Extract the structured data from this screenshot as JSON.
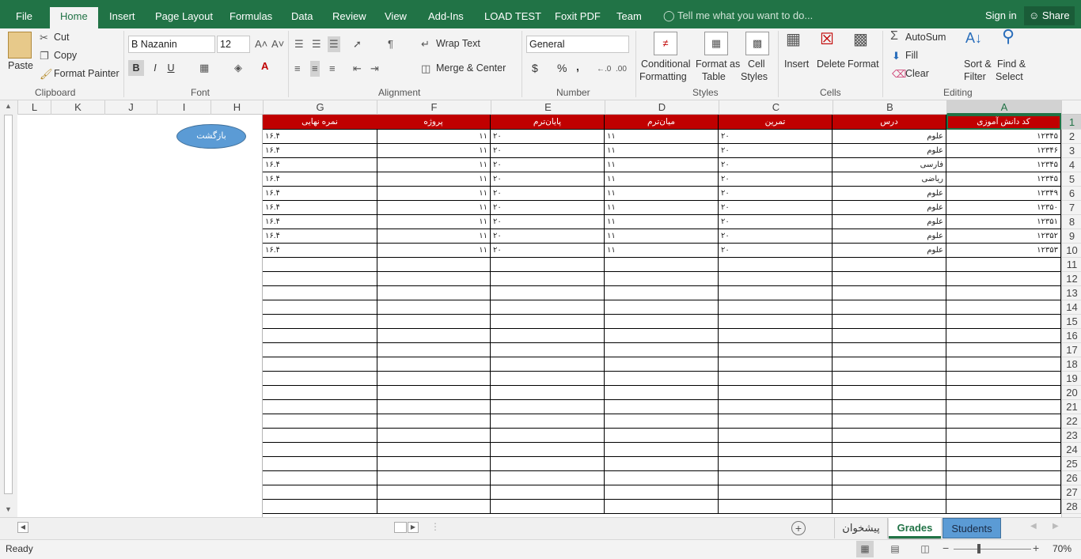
{
  "menu": {
    "file": "File",
    "home": "Home",
    "insert": "Insert",
    "page_layout": "Page Layout",
    "formulas": "Formulas",
    "data": "Data",
    "review": "Review",
    "view": "View",
    "addins": "Add-Ins",
    "loadtest": "LOAD TEST",
    "foxit": "Foxit PDF",
    "team": "Team",
    "tell_me": "Tell me what you want to do...",
    "sign_in": "Sign in",
    "share": "Share"
  },
  "ribbon": {
    "paste": "Paste",
    "cut": "Cut",
    "copy": "Copy",
    "format_painter": "Format Painter",
    "clipboard": "Clipboard",
    "font_name": "B Nazanin",
    "font_size": "12",
    "bold": "B",
    "italic": "I",
    "underline": "U",
    "font": "Font",
    "wrap_text": "Wrap Text",
    "merge_center": "Merge & Center",
    "alignment": "Alignment",
    "number_format": "General",
    "currency": "$",
    "percent": "%",
    "comma": ",",
    "number": "Number",
    "conditional_1": "Conditional",
    "conditional_2": "Formatting",
    "format_table_1": "Format as",
    "format_table_2": "Table",
    "cell_styles_1": "Cell",
    "cell_styles_2": "Styles",
    "styles": "Styles",
    "insert": "Insert",
    "delete": "Delete",
    "format": "Format",
    "cells": "Cells",
    "autosum": "AutoSum",
    "fill": "Fill",
    "clear": "Clear",
    "sort_1": "Sort &",
    "sort_2": "Filter",
    "find_1": "Find &",
    "find_2": "Select",
    "editing": "Editing"
  },
  "columns": [
    "L",
    "K",
    "J",
    "I",
    "H",
    "G",
    "F",
    "E",
    "D",
    "C",
    "B",
    "A"
  ],
  "row_numbers": [
    "1",
    "2",
    "3",
    "4",
    "5",
    "6",
    "7",
    "8",
    "9",
    "10",
    "11",
    "12",
    "13",
    "14",
    "15",
    "16",
    "17",
    "18",
    "19",
    "20",
    "21",
    "22",
    "23",
    "24",
    "25",
    "26",
    "27",
    "28"
  ],
  "sheet": {
    "headers": [
      "نمره نهایی",
      "پروژه",
      "پایان‌ترم",
      "میان‌ترم",
      "تمرین",
      "درس",
      "کد دانش آموزی"
    ],
    "rows": [
      [
        "۱۶.۴",
        "۱۱",
        "۲۰",
        "۱۱",
        "۲۰",
        "علوم",
        "۱۲۳۴۵"
      ],
      [
        "۱۶.۴",
        "۱۱",
        "۲۰",
        "۱۱",
        "۲۰",
        "علوم",
        "۱۲۳۴۶"
      ],
      [
        "۱۶.۴",
        "۱۱",
        "۲۰",
        "۱۱",
        "۲۰",
        "فارسی",
        "۱۲۳۴۵"
      ],
      [
        "۱۶.۴",
        "۱۱",
        "۲۰",
        "۱۱",
        "۲۰",
        "ریاضی",
        "۱۲۳۴۵"
      ],
      [
        "۱۶.۴",
        "۱۱",
        "۲۰",
        "۱۱",
        "۲۰",
        "علوم",
        "۱۲۳۴۹"
      ],
      [
        "۱۶.۴",
        "۱۱",
        "۲۰",
        "۱۱",
        "۲۰",
        "علوم",
        "۱۲۳۵۰"
      ],
      [
        "۱۶.۴",
        "۱۱",
        "۲۰",
        "۱۱",
        "۲۰",
        "علوم",
        "۱۲۳۵۱"
      ],
      [
        "۱۶.۴",
        "۱۱",
        "۲۰",
        "۱۱",
        "۲۰",
        "علوم",
        "۱۲۳۵۲"
      ],
      [
        "۱۶.۴",
        "۱۱",
        "۲۰",
        "۱۱",
        "۲۰",
        "علوم",
        "۱۲۳۵۳"
      ]
    ],
    "back_button": "بازگشت"
  },
  "tabs": [
    "پیشخوان",
    "Grades",
    "Students"
  ],
  "status": {
    "ready": "Ready",
    "zoom": "70%"
  },
  "colors": {
    "excel_green": "#217346",
    "header_red": "#c00000",
    "tab_blue": "#5b9bd5"
  }
}
